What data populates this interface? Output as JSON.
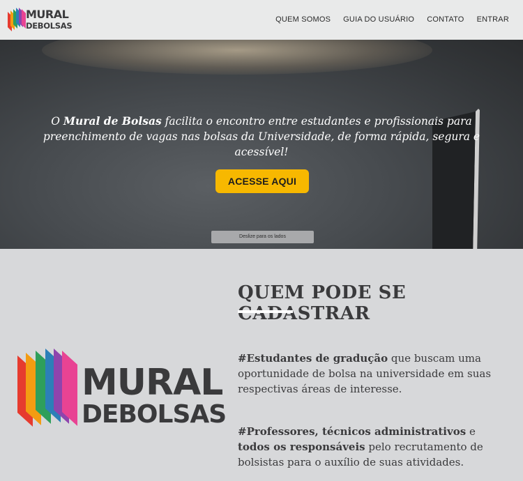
{
  "header": {
    "logo_line1": "MURAL",
    "logo_line2": "DEBOLSAS",
    "nav": [
      "QUEM SOMOS",
      "GUIA DO USUÁRIO",
      "CONTATO",
      "ENTRAR"
    ]
  },
  "hero": {
    "caption_pre": "O ",
    "caption_bold": "Mural de Bolsas",
    "caption_post": " facilita o encontro entre estudantes e profissionais para preenchimento de vagas nas bolsas da Universidade, de forma rápida, segura e acessível!",
    "cta_label": "ACESSE AQUI",
    "swipe_hint": "Deslize para os lados"
  },
  "section": {
    "title": "QUEM PODE SE CADASTRAR",
    "logo_line1": "MURAL",
    "logo_line2": "DEBOLSAS",
    "p1_bold": "#Estudantes de gradução",
    "p1_rest": " que buscam uma oportunidade de bolsa na universidade em suas respectivas áreas de interesse.",
    "p2_bold1": "#Professores, técnicos administrativos",
    "p2_mid": " e ",
    "p2_bold2": "todos os responsáveis",
    "p2_rest": " pelo recrutamento de bolsistas para o auxílio de suas atividades."
  },
  "colors": {
    "accent": "#f7b800",
    "text_dark": "#3a3a3c",
    "logo_stripes": [
      "#e63b2e",
      "#f39c12",
      "#2e9f5b",
      "#2c7fb8",
      "#8e44ad",
      "#e84393"
    ]
  }
}
